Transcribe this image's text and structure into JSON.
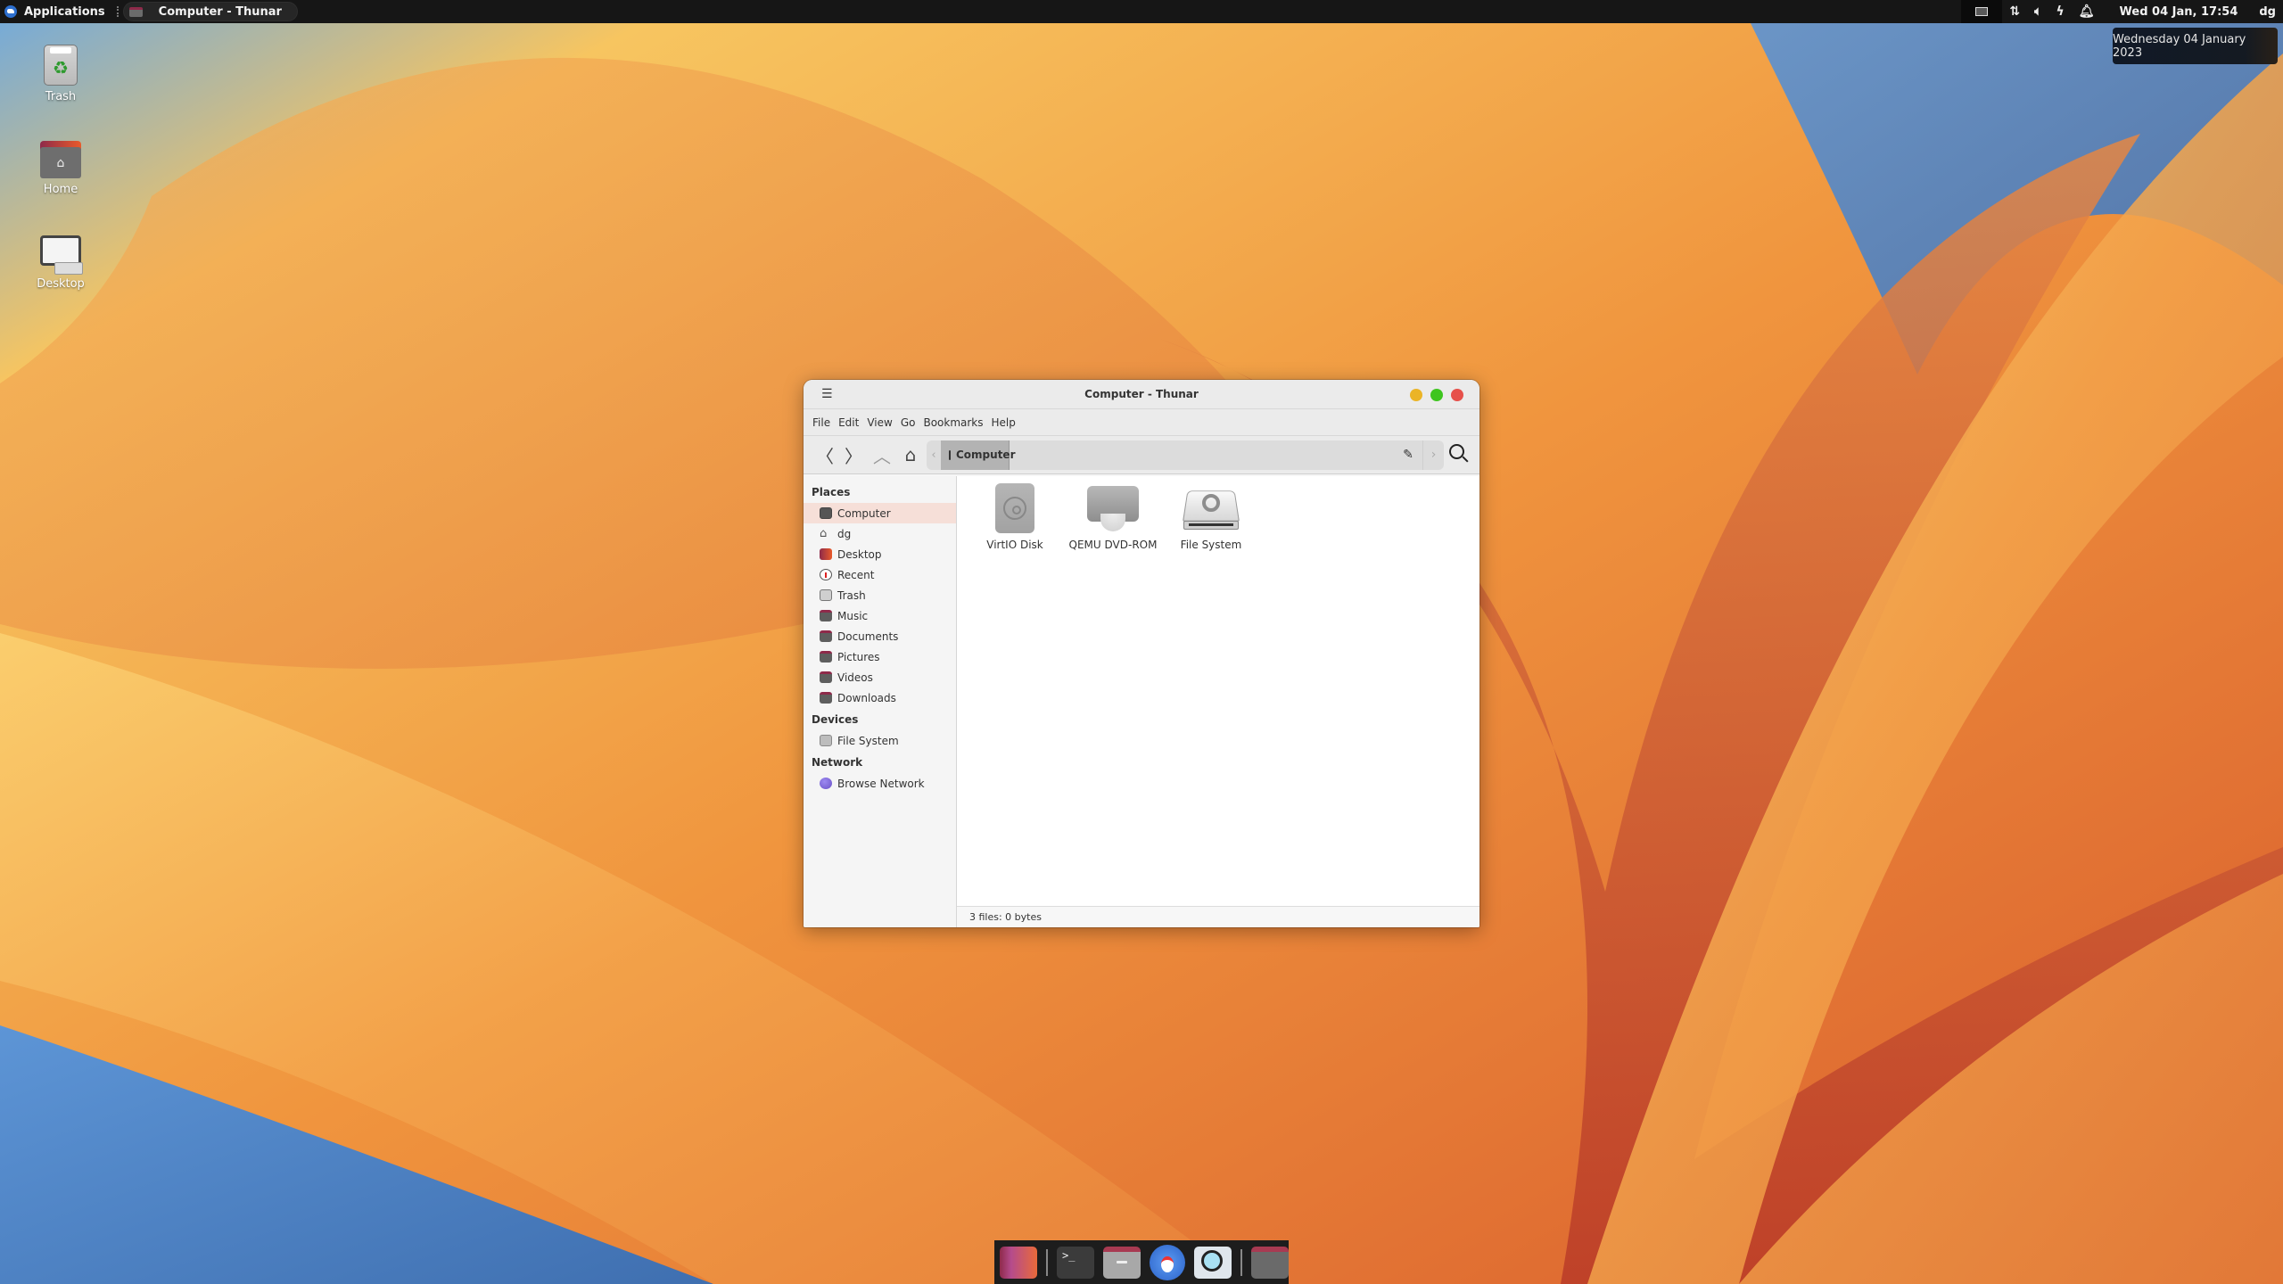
{
  "top_panel": {
    "applications_label": "Applications",
    "task_title": "Computer - Thunar",
    "clock": "Wed 04 Jan, 17:54",
    "user": "dg",
    "tray_icons": [
      "workspace-switcher-icon",
      "network-icon",
      "volume-icon",
      "power-icon",
      "notification-bell-icon"
    ]
  },
  "date_tooltip": "Wednesday 04 January 2023",
  "desktop_icons": [
    {
      "label": "Trash",
      "icon": "trash-icon"
    },
    {
      "label": "Home",
      "icon": "home-folder-icon"
    },
    {
      "label": "Desktop",
      "icon": "desktop-computer-icon"
    }
  ],
  "window": {
    "title": "Computer - Thunar",
    "menu": [
      "File",
      "Edit",
      "View",
      "Go",
      "Bookmarks",
      "Help"
    ],
    "toolbar": {
      "back": "〈",
      "forward": "〉",
      "up": "︿",
      "home": "⌂",
      "path_left": "‹",
      "path_right": "›",
      "edit": "✎",
      "current_location": "Computer"
    },
    "sidebar": {
      "sections": [
        {
          "title": "Places",
          "items": [
            {
              "label": "Computer",
              "icon": "computer-icon",
              "active": true
            },
            {
              "label": "dg",
              "icon": "home-icon"
            },
            {
              "label": "Desktop",
              "icon": "desktop-icon"
            },
            {
              "label": "Recent",
              "icon": "recent-clock-icon"
            },
            {
              "label": "Trash",
              "icon": "trash-icon"
            },
            {
              "label": "Music",
              "icon": "music-folder-icon"
            },
            {
              "label": "Documents",
              "icon": "documents-folder-icon"
            },
            {
              "label": "Pictures",
              "icon": "pictures-folder-icon"
            },
            {
              "label": "Videos",
              "icon": "videos-folder-icon"
            },
            {
              "label": "Downloads",
              "icon": "downloads-folder-icon"
            }
          ]
        },
        {
          "title": "Devices",
          "items": [
            {
              "label": "File System",
              "icon": "drive-icon"
            }
          ]
        },
        {
          "title": "Network",
          "items": [
            {
              "label": "Browse Network",
              "icon": "network-globe-icon"
            }
          ]
        }
      ]
    },
    "files": [
      {
        "name": "VirtIO Disk",
        "icon": "hard-disk-icon"
      },
      {
        "name": "QEMU DVD-ROM",
        "icon": "optical-drive-icon"
      },
      {
        "name": "File System",
        "icon": "filesystem-drive-icon"
      }
    ],
    "status": "3 files: 0 bytes"
  },
  "dock": {
    "items": [
      "desktop-app-icon",
      "terminal-icon",
      "file-manager-icon",
      "web-browser-icon",
      "app-finder-icon",
      "home-folder-icon"
    ],
    "terminal_glyph": ">_"
  }
}
